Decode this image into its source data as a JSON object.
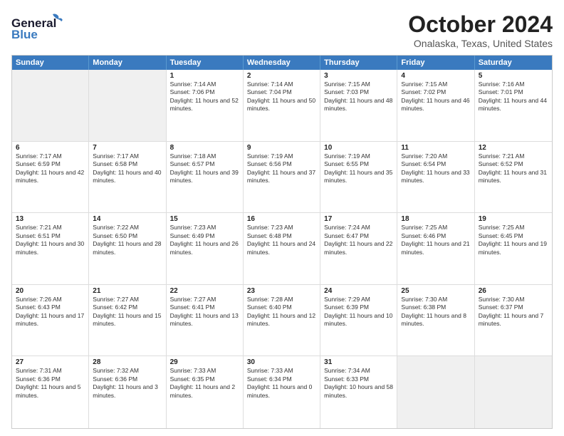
{
  "header": {
    "logo_general": "General",
    "logo_blue": "Blue",
    "main_title": "October 2024",
    "sub_title": "Onalaska, Texas, United States"
  },
  "days_of_week": [
    "Sunday",
    "Monday",
    "Tuesday",
    "Wednesday",
    "Thursday",
    "Friday",
    "Saturday"
  ],
  "weeks": [
    [
      {
        "day": "",
        "sunrise": "",
        "sunset": "",
        "daylight": "",
        "shaded": true
      },
      {
        "day": "",
        "sunrise": "",
        "sunset": "",
        "daylight": "",
        "shaded": true
      },
      {
        "day": "1",
        "sunrise": "Sunrise: 7:14 AM",
        "sunset": "Sunset: 7:06 PM",
        "daylight": "Daylight: 11 hours and 52 minutes."
      },
      {
        "day": "2",
        "sunrise": "Sunrise: 7:14 AM",
        "sunset": "Sunset: 7:04 PM",
        "daylight": "Daylight: 11 hours and 50 minutes."
      },
      {
        "day": "3",
        "sunrise": "Sunrise: 7:15 AM",
        "sunset": "Sunset: 7:03 PM",
        "daylight": "Daylight: 11 hours and 48 minutes."
      },
      {
        "day": "4",
        "sunrise": "Sunrise: 7:15 AM",
        "sunset": "Sunset: 7:02 PM",
        "daylight": "Daylight: 11 hours and 46 minutes."
      },
      {
        "day": "5",
        "sunrise": "Sunrise: 7:16 AM",
        "sunset": "Sunset: 7:01 PM",
        "daylight": "Daylight: 11 hours and 44 minutes."
      }
    ],
    [
      {
        "day": "6",
        "sunrise": "Sunrise: 7:17 AM",
        "sunset": "Sunset: 6:59 PM",
        "daylight": "Daylight: 11 hours and 42 minutes."
      },
      {
        "day": "7",
        "sunrise": "Sunrise: 7:17 AM",
        "sunset": "Sunset: 6:58 PM",
        "daylight": "Daylight: 11 hours and 40 minutes."
      },
      {
        "day": "8",
        "sunrise": "Sunrise: 7:18 AM",
        "sunset": "Sunset: 6:57 PM",
        "daylight": "Daylight: 11 hours and 39 minutes."
      },
      {
        "day": "9",
        "sunrise": "Sunrise: 7:19 AM",
        "sunset": "Sunset: 6:56 PM",
        "daylight": "Daylight: 11 hours and 37 minutes."
      },
      {
        "day": "10",
        "sunrise": "Sunrise: 7:19 AM",
        "sunset": "Sunset: 6:55 PM",
        "daylight": "Daylight: 11 hours and 35 minutes."
      },
      {
        "day": "11",
        "sunrise": "Sunrise: 7:20 AM",
        "sunset": "Sunset: 6:54 PM",
        "daylight": "Daylight: 11 hours and 33 minutes."
      },
      {
        "day": "12",
        "sunrise": "Sunrise: 7:21 AM",
        "sunset": "Sunset: 6:52 PM",
        "daylight": "Daylight: 11 hours and 31 minutes."
      }
    ],
    [
      {
        "day": "13",
        "sunrise": "Sunrise: 7:21 AM",
        "sunset": "Sunset: 6:51 PM",
        "daylight": "Daylight: 11 hours and 30 minutes."
      },
      {
        "day": "14",
        "sunrise": "Sunrise: 7:22 AM",
        "sunset": "Sunset: 6:50 PM",
        "daylight": "Daylight: 11 hours and 28 minutes."
      },
      {
        "day": "15",
        "sunrise": "Sunrise: 7:23 AM",
        "sunset": "Sunset: 6:49 PM",
        "daylight": "Daylight: 11 hours and 26 minutes."
      },
      {
        "day": "16",
        "sunrise": "Sunrise: 7:23 AM",
        "sunset": "Sunset: 6:48 PM",
        "daylight": "Daylight: 11 hours and 24 minutes."
      },
      {
        "day": "17",
        "sunrise": "Sunrise: 7:24 AM",
        "sunset": "Sunset: 6:47 PM",
        "daylight": "Daylight: 11 hours and 22 minutes."
      },
      {
        "day": "18",
        "sunrise": "Sunrise: 7:25 AM",
        "sunset": "Sunset: 6:46 PM",
        "daylight": "Daylight: 11 hours and 21 minutes."
      },
      {
        "day": "19",
        "sunrise": "Sunrise: 7:25 AM",
        "sunset": "Sunset: 6:45 PM",
        "daylight": "Daylight: 11 hours and 19 minutes."
      }
    ],
    [
      {
        "day": "20",
        "sunrise": "Sunrise: 7:26 AM",
        "sunset": "Sunset: 6:43 PM",
        "daylight": "Daylight: 11 hours and 17 minutes."
      },
      {
        "day": "21",
        "sunrise": "Sunrise: 7:27 AM",
        "sunset": "Sunset: 6:42 PM",
        "daylight": "Daylight: 11 hours and 15 minutes."
      },
      {
        "day": "22",
        "sunrise": "Sunrise: 7:27 AM",
        "sunset": "Sunset: 6:41 PM",
        "daylight": "Daylight: 11 hours and 13 minutes."
      },
      {
        "day": "23",
        "sunrise": "Sunrise: 7:28 AM",
        "sunset": "Sunset: 6:40 PM",
        "daylight": "Daylight: 11 hours and 12 minutes."
      },
      {
        "day": "24",
        "sunrise": "Sunrise: 7:29 AM",
        "sunset": "Sunset: 6:39 PM",
        "daylight": "Daylight: 11 hours and 10 minutes."
      },
      {
        "day": "25",
        "sunrise": "Sunrise: 7:30 AM",
        "sunset": "Sunset: 6:38 PM",
        "daylight": "Daylight: 11 hours and 8 minutes."
      },
      {
        "day": "26",
        "sunrise": "Sunrise: 7:30 AM",
        "sunset": "Sunset: 6:37 PM",
        "daylight": "Daylight: 11 hours and 7 minutes."
      }
    ],
    [
      {
        "day": "27",
        "sunrise": "Sunrise: 7:31 AM",
        "sunset": "Sunset: 6:36 PM",
        "daylight": "Daylight: 11 hours and 5 minutes."
      },
      {
        "day": "28",
        "sunrise": "Sunrise: 7:32 AM",
        "sunset": "Sunset: 6:36 PM",
        "daylight": "Daylight: 11 hours and 3 minutes."
      },
      {
        "day": "29",
        "sunrise": "Sunrise: 7:33 AM",
        "sunset": "Sunset: 6:35 PM",
        "daylight": "Daylight: 11 hours and 2 minutes."
      },
      {
        "day": "30",
        "sunrise": "Sunrise: 7:33 AM",
        "sunset": "Sunset: 6:34 PM",
        "daylight": "Daylight: 11 hours and 0 minutes."
      },
      {
        "day": "31",
        "sunrise": "Sunrise: 7:34 AM",
        "sunset": "Sunset: 6:33 PM",
        "daylight": "Daylight: 10 hours and 58 minutes."
      },
      {
        "day": "",
        "sunrise": "",
        "sunset": "",
        "daylight": "",
        "shaded": true
      },
      {
        "day": "",
        "sunrise": "",
        "sunset": "",
        "daylight": "",
        "shaded": true
      }
    ]
  ]
}
